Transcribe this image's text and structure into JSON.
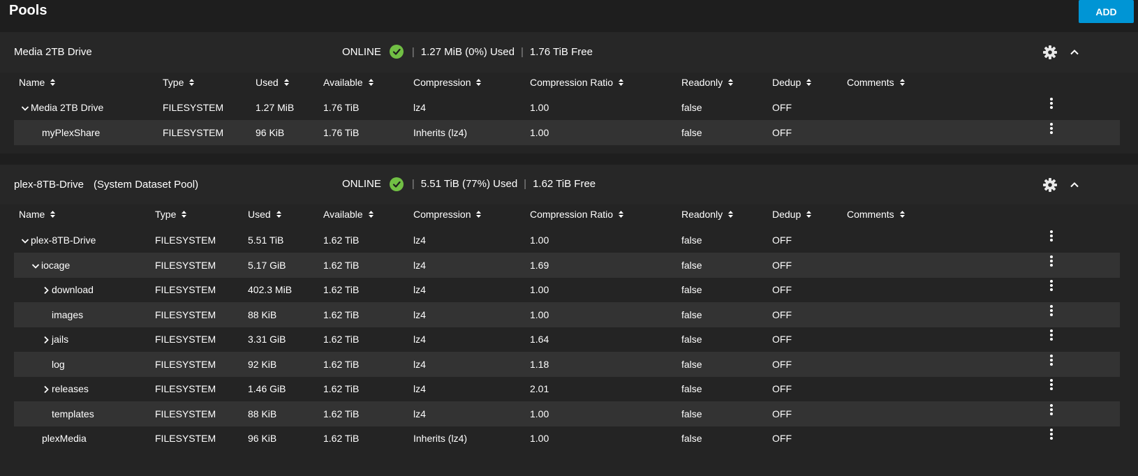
{
  "page": {
    "title": "Pools",
    "add_label": "ADD"
  },
  "columns": [
    "Name",
    "Type",
    "Used",
    "Available",
    "Compression",
    "Compression Ratio",
    "Readonly",
    "Dedup",
    "Comments"
  ],
  "pools": [
    {
      "name": "Media 2TB Drive",
      "system_label": "",
      "status": "ONLINE",
      "used": "1.27 MiB (0%) Used",
      "free": "1.76 TiB Free",
      "rows": [
        {
          "name": "Media 2TB Drive",
          "expander": "down",
          "type": "FILESYSTEM",
          "used": "1.27 MiB",
          "available": "1.76 TiB",
          "compression": "lz4",
          "ratio": "1.00",
          "readonly": "false",
          "dedup": "OFF",
          "comments": ""
        },
        {
          "name": "myPlexShare",
          "expander": "",
          "type": "FILESYSTEM",
          "used": "96 KiB",
          "available": "1.76 TiB",
          "compression": "Inherits (lz4)",
          "ratio": "1.00",
          "readonly": "false",
          "dedup": "OFF",
          "comments": ""
        }
      ]
    },
    {
      "name": "plex-8TB-Drive",
      "system_label": "(System Dataset Pool)",
      "status": "ONLINE",
      "used": "5.51 TiB (77%) Used",
      "free": "1.62 TiB Free",
      "rows": [
        {
          "name": "plex-8TB-Drive",
          "expander": "down",
          "type": "FILESYSTEM",
          "used": "5.51 TiB",
          "available": "1.62 TiB",
          "compression": "lz4",
          "ratio": "1.00",
          "readonly": "false",
          "dedup": "OFF",
          "comments": ""
        },
        {
          "name": "iocage",
          "expander": "down",
          "type": "FILESYSTEM",
          "used": "5.17 GiB",
          "available": "1.62 TiB",
          "compression": "lz4",
          "ratio": "1.69",
          "readonly": "false",
          "dedup": "OFF",
          "comments": ""
        },
        {
          "name": "download",
          "expander": "right",
          "type": "FILESYSTEM",
          "used": "402.3 MiB",
          "available": "1.62 TiB",
          "compression": "lz4",
          "ratio": "1.00",
          "readonly": "false",
          "dedup": "OFF",
          "comments": ""
        },
        {
          "name": "images",
          "expander": "",
          "type": "FILESYSTEM",
          "used": "88 KiB",
          "available": "1.62 TiB",
          "compression": "lz4",
          "ratio": "1.00",
          "readonly": "false",
          "dedup": "OFF",
          "comments": ""
        },
        {
          "name": "jails",
          "expander": "right",
          "type": "FILESYSTEM",
          "used": "3.31 GiB",
          "available": "1.62 TiB",
          "compression": "lz4",
          "ratio": "1.64",
          "readonly": "false",
          "dedup": "OFF",
          "comments": ""
        },
        {
          "name": "log",
          "expander": "",
          "type": "FILESYSTEM",
          "used": "92 KiB",
          "available": "1.62 TiB",
          "compression": "lz4",
          "ratio": "1.18",
          "readonly": "false",
          "dedup": "OFF",
          "comments": ""
        },
        {
          "name": "releases",
          "expander": "right",
          "type": "FILESYSTEM",
          "used": "1.46 GiB",
          "available": "1.62 TiB",
          "compression": "lz4",
          "ratio": "2.01",
          "readonly": "false",
          "dedup": "OFF",
          "comments": ""
        },
        {
          "name": "templates",
          "expander": "",
          "type": "FILESYSTEM",
          "used": "88 KiB",
          "available": "1.62 TiB",
          "compression": "lz4",
          "ratio": "1.00",
          "readonly": "false",
          "dedup": "OFF",
          "comments": ""
        },
        {
          "name": "plexMedia",
          "expander": "",
          "type": "FILESYSTEM",
          "used": "96 KiB",
          "available": "1.62 TiB",
          "compression": "Inherits (lz4)",
          "ratio": "1.00",
          "readonly": "false",
          "dedup": "OFF",
          "comments": ""
        }
      ]
    }
  ],
  "colors": {
    "accent": "#0095d5",
    "online": "#71bf44",
    "background": "#1e1e1e",
    "card": "#242424",
    "row_stripe": "#333333"
  },
  "icons": {
    "status": "check-circle-icon",
    "settings": "gear-icon",
    "collapse": "chevron-up-icon",
    "sort": "sort-icon",
    "actions": "more-vert-icon",
    "expand": "chevron-down-icon",
    "collapsed": "chevron-right-icon"
  }
}
